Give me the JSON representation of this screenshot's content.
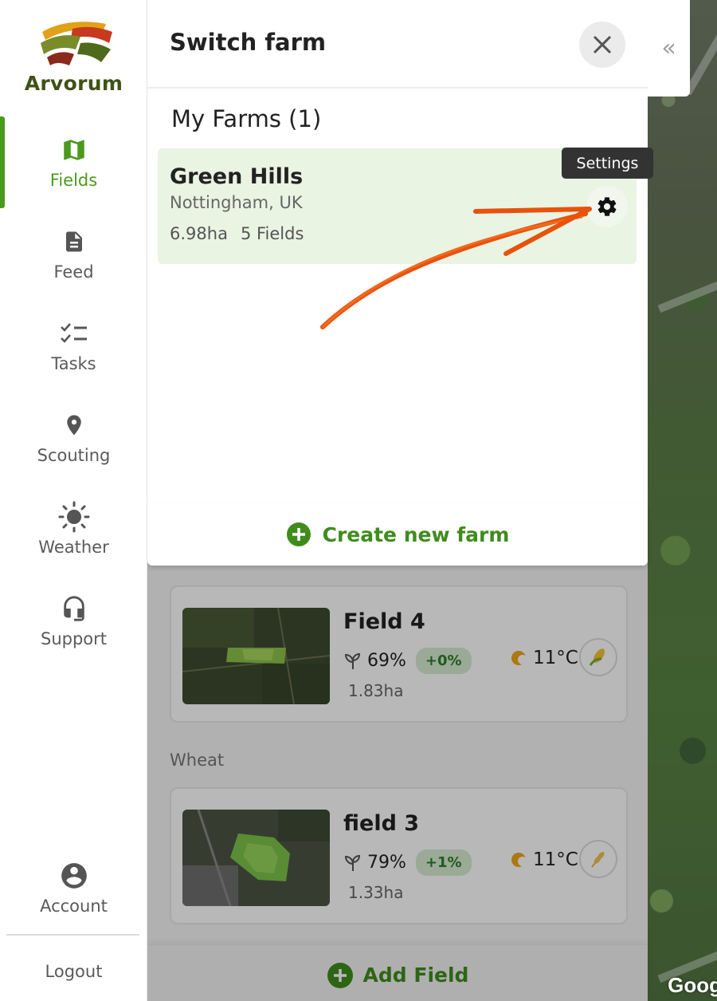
{
  "app": {
    "name": "Arvorum"
  },
  "sidebar": {
    "items": [
      {
        "label": "Fields",
        "icon": "map-icon",
        "active": true
      },
      {
        "label": "Feed",
        "icon": "document-icon"
      },
      {
        "label": "Tasks",
        "icon": "checklist-icon"
      },
      {
        "label": "Scouting",
        "icon": "location-pin-icon"
      },
      {
        "label": "Weather",
        "icon": "sun-icon"
      },
      {
        "label": "Support",
        "icon": "headset-icon"
      }
    ],
    "account_label": "Account",
    "logout_label": "Logout"
  },
  "panel": {
    "title": "Switch farm",
    "farms_heading": "My Farms (1)",
    "farm": {
      "name": "Green Hills",
      "location": "Nottingham, UK",
      "area": "6.98ha",
      "fields": "5 Fields"
    },
    "settings_tooltip": "Settings",
    "create_label": "Create new farm"
  },
  "field_list": {
    "fields": [
      {
        "name": "Field 4",
        "ndvi": "69%",
        "change": "+0%",
        "temp": "11°C",
        "area": "1.83ha"
      },
      {
        "name": "field 3",
        "ndvi": "79%",
        "change": "+1%",
        "temp": "11°C",
        "area": "1.33ha"
      }
    ],
    "section_label": "Wheat",
    "add_field_label": "Add Field"
  },
  "map": {
    "attribution": "Goog"
  },
  "colors": {
    "brand_green": "#4a9b1c",
    "accent_orange": "#e8520c",
    "active_farm_bg": "#e9f4e3"
  }
}
